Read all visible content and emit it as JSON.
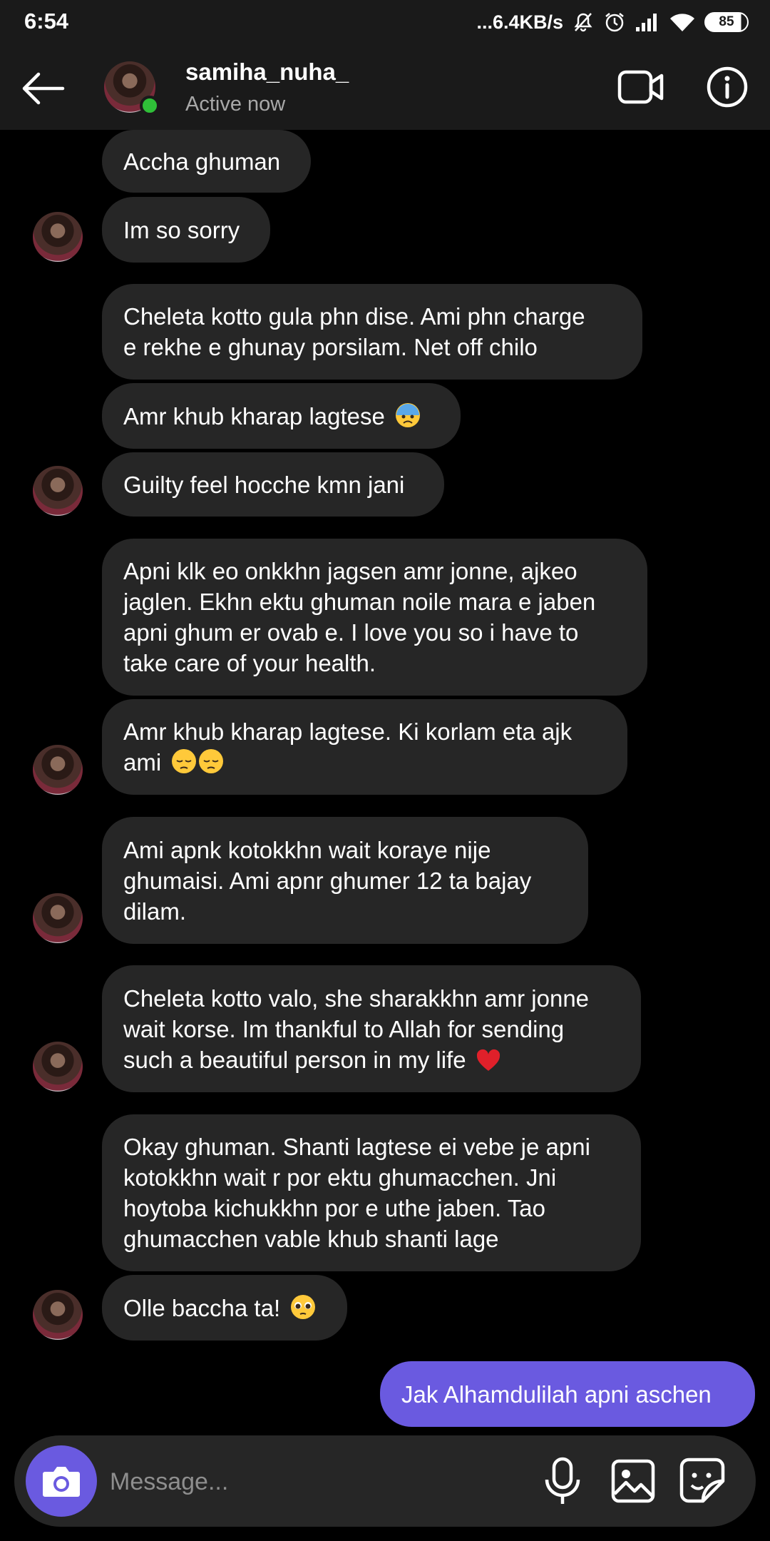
{
  "status_bar": {
    "time": "6:54",
    "net_speed": "...6.4KB/s",
    "battery": "85",
    "icons": [
      "mute-icon",
      "alarm-icon",
      "signal-icon",
      "wifi-icon",
      "battery-icon"
    ]
  },
  "header": {
    "username": "samiha_nuha_",
    "status": "Active now",
    "icons": [
      "back-arrow-icon",
      "video-call-icon",
      "info-icon"
    ],
    "online_color": "#2fbf38"
  },
  "messages": [
    {
      "side": "received",
      "lines": [
        "Accha ghuman"
      ]
    },
    {
      "side": "received",
      "lines": [
        "Im so sorry"
      ]
    },
    {
      "side": "received",
      "lines": [
        "Cheleta kotto gula phn dise. Ami phn charge",
        "e rekhe e ghunay porsilam. Net off chilo"
      ]
    },
    {
      "side": "received",
      "lines": [
        "Amr khub kharap lagtese"
      ],
      "emoji": "anxious-face-emoji"
    },
    {
      "side": "received",
      "lines": [
        "Guilty feel hocche kmn jani"
      ]
    },
    {
      "side": "received",
      "lines": [
        "Apni klk eo onkkhn jagsen amr jonne, ajkeo",
        "jaglen. Ekhn ektu ghuman noile mara e jaben",
        "apni ghum er ovab e. I love you so i have to",
        "take care of your health."
      ]
    },
    {
      "side": "received",
      "lines": [
        "Amr khub kharap lagtese. Ki korlam eta ajk",
        "ami"
      ],
      "emoji": "pensive-face-emoji x2"
    },
    {
      "side": "received",
      "lines": [
        "Ami apnk kotokkhn wait koraye nije",
        "ghumaisi. Ami apnr ghumer 12 ta bajay",
        "dilam."
      ]
    },
    {
      "side": "received",
      "lines": [
        "Cheleta kotto valo, she sharakkhn amr jonne",
        "wait korse. Im thankful to Allah for sending",
        "such a beautiful person in my life"
      ],
      "emoji": "red-heart-emoji"
    },
    {
      "side": "received",
      "lines": [
        "Okay ghuman. Shanti lagtese ei vebe je apni",
        "kotokkhn wait r por ektu ghumacchen. Jni",
        "hoytoba kichukkhn por e uthe jaben. Tao",
        "ghumacchen vable khub shanti lage"
      ]
    },
    {
      "side": "received",
      "lines": [
        "Olle baccha ta!"
      ],
      "emoji": "pleading-face-emoji"
    },
    {
      "side": "sent",
      "lines": [
        "Jak Alhamdulilah apni aschen"
      ]
    }
  ],
  "composer": {
    "placeholder": "Message...",
    "icons": [
      "camera-icon",
      "microphone-icon",
      "gallery-icon",
      "sticker-icon"
    ],
    "accent_color": "#6a5ae0"
  },
  "colors": {
    "background": "#000000",
    "header_bg": "#1a1a1a",
    "received_bubble": "#262626",
    "sent_bubble": "#6a5ae0"
  }
}
